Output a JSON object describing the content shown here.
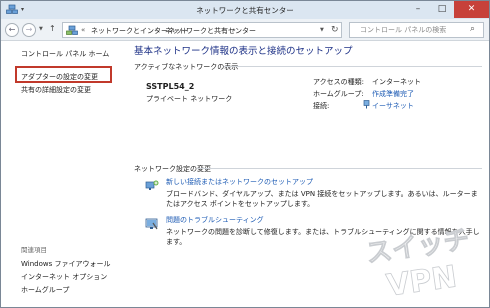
{
  "window": {
    "title": "ネットワークと共有センター",
    "minimize": "–",
    "maximize": "□",
    "close": "✕"
  },
  "address": {
    "crumb_1": "ネットワークとインターネット",
    "crumb_2": "ネットワークと共有センター",
    "separator": "›",
    "chevron": "«",
    "search_placeholder": "コントロール パネルの検索"
  },
  "sidebar": {
    "home": "コントロール パネル ホーム",
    "links": [
      "アダプターの設定の変更",
      "共有の詳細設定の変更"
    ],
    "related_heading": "関連項目",
    "related": [
      "Windows ファイアウォール",
      "インターネット オプション",
      "ホームグループ"
    ]
  },
  "main": {
    "title": "基本ネットワーク情報の表示と接続のセットアップ",
    "active_heading": "アクティブなネットワークの表示",
    "network": {
      "name": "SSTPL54_2",
      "type": "プライベート ネットワーク",
      "access_label": "アクセスの種類:",
      "access_value": "インターネット",
      "homegroup_label": "ホームグループ:",
      "homegroup_value": "作成準備完了",
      "connection_label": "接続:",
      "connection_value": "イーサネット"
    },
    "settings_heading": "ネットワーク設定の変更",
    "tasks": [
      {
        "link": "新しい接続またはネットワークのセットアップ",
        "desc": "ブロードバンド、ダイヤルアップ、または VPN 接続をセットアップします。あるいは、ルーターまたはアクセス ポイントをセットアップします。"
      },
      {
        "link": "問題のトラブルシューティング",
        "desc": "ネットワークの問題を診断して修復します。または、トラブルシューティングに関する情報を入手します。"
      }
    ]
  },
  "watermark": {
    "line_1": "スイッチ",
    "line_2": "VPN"
  },
  "colors": {
    "link": "#1d5bb4",
    "title": "#1e3287",
    "highlight": "#c1392b",
    "close": "#c7413a"
  }
}
